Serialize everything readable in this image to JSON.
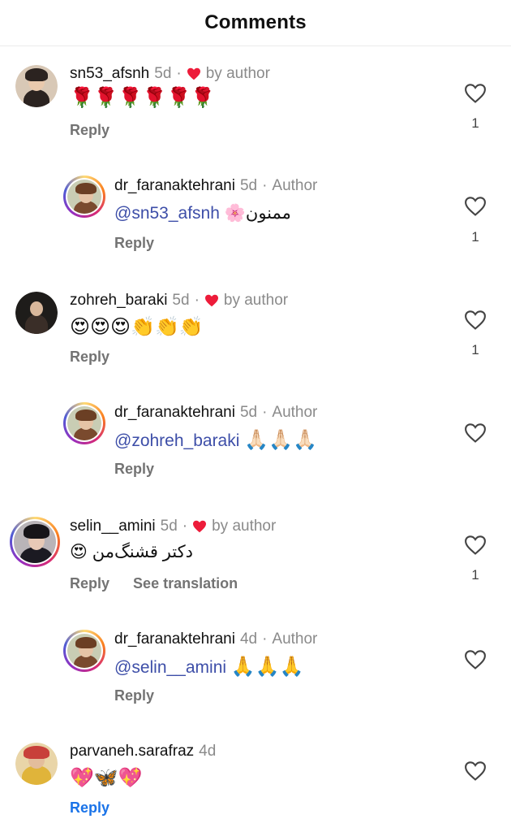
{
  "header": {
    "title": "Comments"
  },
  "comments": [
    {
      "user": "sn53_afsnh",
      "time": "5d",
      "by_author": "by author",
      "text": "🌹🌹🌹🌹🌹🌹",
      "reply": "Reply",
      "likes": "1",
      "reply_comment": {
        "user": "dr_faranaktehrani",
        "time": "5d",
        "tag": "Author",
        "mention": "@sn53_afsnh",
        "text": "ممنون🌸",
        "reply": "Reply",
        "likes": "1"
      }
    },
    {
      "user": "zohreh_baraki",
      "time": "5d",
      "by_author": "by author",
      "text": "😍😍😍👏👏👏",
      "reply": "Reply",
      "likes": "1",
      "reply_comment": {
        "user": "dr_faranaktehrani",
        "time": "5d",
        "tag": "Author",
        "mention": "@zohreh_baraki",
        "text": "🙏🏻🙏🏻🙏🏻",
        "reply": "Reply"
      }
    },
    {
      "user": "selin__amini",
      "time": "5d",
      "by_author": "by author",
      "text": "دکتر قشنگ‌من 😍",
      "reply": "Reply",
      "translate": "See translation",
      "likes": "1",
      "reply_comment": {
        "user": "dr_faranaktehrani",
        "time": "4d",
        "tag": "Author",
        "mention": "@selin__amini",
        "text": "🙏🙏🙏",
        "reply": "Reply"
      }
    },
    {
      "user": "parvaneh.sarafraz",
      "time": "4d",
      "text": "💖🦋💖",
      "reply": "Reply"
    }
  ],
  "icons": {
    "like": "heart-outline-icon",
    "author_like": "red-heart-icon"
  },
  "colors": {
    "mention": "#3d4ea8",
    "heart": "#ed1c3a",
    "reply_link": "#1a73e8"
  }
}
